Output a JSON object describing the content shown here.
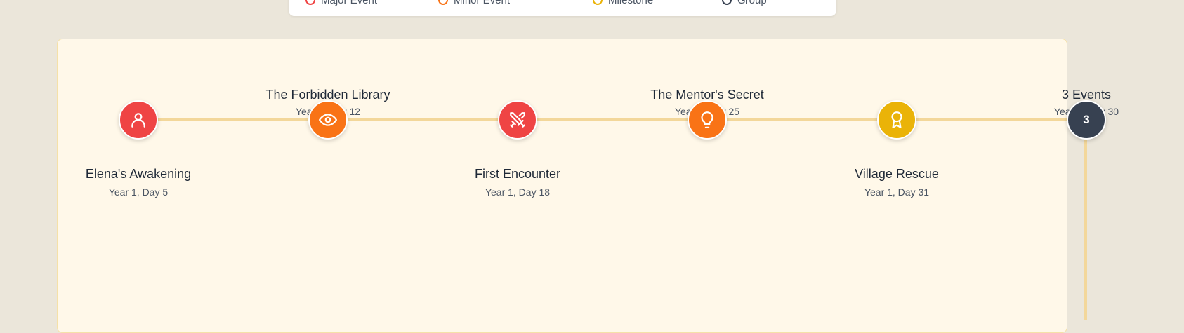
{
  "legend": {
    "items": [
      {
        "label": "Major Event",
        "color": "#ef4444"
      },
      {
        "label": "Minor Event",
        "color": "#f97316"
      },
      {
        "label": "Milestone",
        "color": "#eab308"
      },
      {
        "label": "Group",
        "color": "#374151"
      }
    ]
  },
  "timeline": {
    "events": [
      {
        "title": "Elena's Awakening",
        "date": "Year 1, Day 5",
        "icon": "user-icon",
        "color": "#ef4444"
      },
      {
        "title": "The Forbidden Library",
        "date": "Year 1, Day 12",
        "icon": "eye-icon",
        "color": "#f97316"
      },
      {
        "title": "First Encounter",
        "date": "Year 1, Day 18",
        "icon": "crossed-swords-icon",
        "color": "#ef4444"
      },
      {
        "title": "The Mentor's Secret",
        "date": "Year 1, Day 25",
        "icon": "lightbulb-icon",
        "color": "#f97316"
      },
      {
        "title": "Village Rescue",
        "date": "Year 1, Day 31",
        "icon": "award-icon",
        "color": "#eab308"
      }
    ],
    "group": {
      "title": "3 Events",
      "date": "Year 1, Day 30",
      "count": "3",
      "color": "#374151"
    }
  }
}
